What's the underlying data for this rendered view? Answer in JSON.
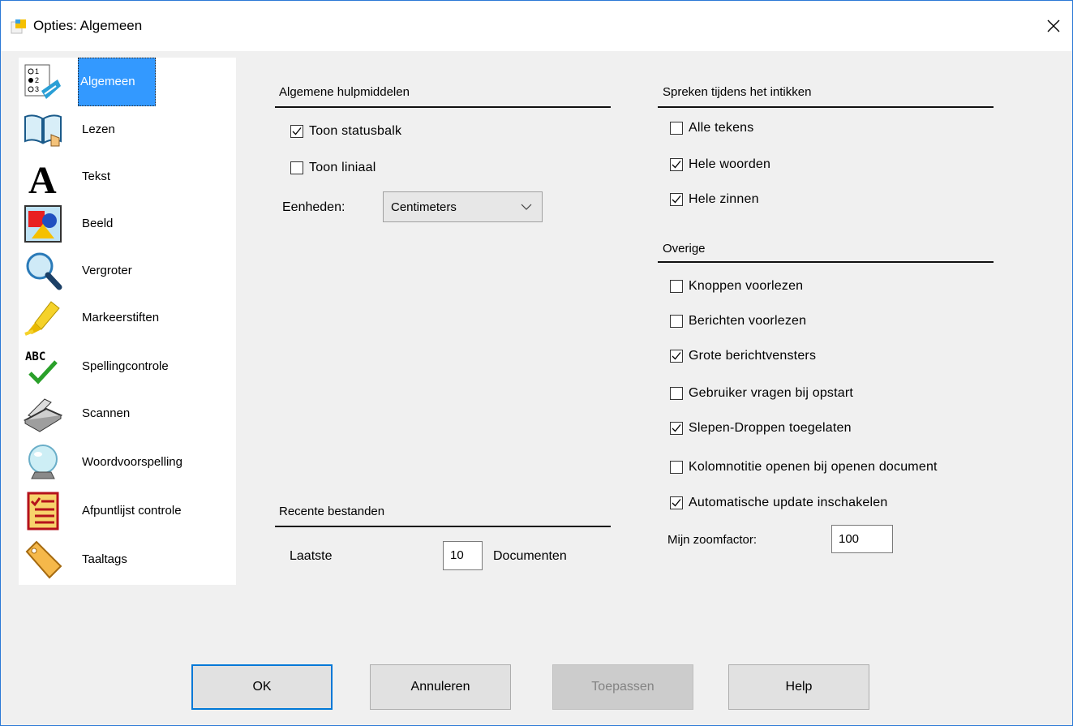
{
  "window": {
    "title": "Opties: Algemeen"
  },
  "sidebar": {
    "items": [
      {
        "label": "Algemeen",
        "icon": "options-list-icon",
        "selected": true
      },
      {
        "label": "Lezen",
        "icon": "book-reading-icon",
        "selected": false
      },
      {
        "label": "Tekst",
        "icon": "letter-a-icon",
        "selected": false
      },
      {
        "label": "Beeld",
        "icon": "shapes-picture-icon",
        "selected": false
      },
      {
        "label": "Vergroter",
        "icon": "magnifier-icon",
        "selected": false
      },
      {
        "label": "Markeerstiften",
        "icon": "highlighter-icon",
        "selected": false
      },
      {
        "label": "Spellingcontrole",
        "icon": "spellcheck-icon",
        "selected": false
      },
      {
        "label": "Scannen",
        "icon": "scanner-icon",
        "selected": false
      },
      {
        "label": "Woordvoorspelling",
        "icon": "crystal-ball-icon",
        "selected": false
      },
      {
        "label": "Afpuntlijst controle",
        "icon": "checklist-icon",
        "selected": false
      },
      {
        "label": "Taaltags",
        "icon": "tag-icon",
        "selected": false
      }
    ]
  },
  "general_tools": {
    "title": "Algemene hulpmiddelen",
    "show_statusbar": {
      "label": "Toon statusbalk",
      "checked": true
    },
    "show_ruler": {
      "label": "Toon liniaal",
      "checked": false
    },
    "units_label": "Eenheden:",
    "units_value": "Centimeters"
  },
  "recent_files": {
    "title": "Recente bestanden",
    "last_label": "Laatste",
    "count": "10",
    "documents_label": "Documenten"
  },
  "typing_speech": {
    "title": "Spreken tijdens het intikken",
    "options": [
      {
        "label": "Alle tekens",
        "checked": false
      },
      {
        "label": "Hele woorden",
        "checked": true
      },
      {
        "label": "Hele zinnen",
        "checked": true
      }
    ]
  },
  "other": {
    "title": "Overige",
    "options": [
      {
        "label": "Knoppen voorlezen",
        "checked": false
      },
      {
        "label": "Berichten voorlezen",
        "checked": false
      },
      {
        "label": "Grote berichtvensters",
        "checked": true
      },
      {
        "label": "Gebruiker vragen bij opstart",
        "checked": false
      },
      {
        "label": "Slepen-Droppen toegelaten",
        "checked": true
      },
      {
        "label": "Kolomnotitie openen bij openen document",
        "checked": false
      },
      {
        "label": "Automatische update inschakelen",
        "checked": true
      }
    ],
    "zoom_label": "Mijn zoomfactor:",
    "zoom_value": "100"
  },
  "buttons": {
    "ok": "OK",
    "cancel": "Annuleren",
    "apply": "Toepassen",
    "help": "Help"
  }
}
